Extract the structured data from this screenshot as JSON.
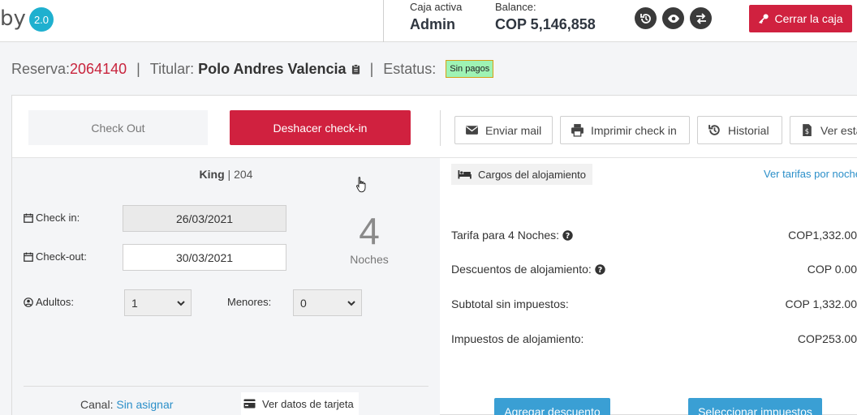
{
  "header": {
    "logo_text": "by",
    "version_badge": "2.0",
    "cash_register_label": "Caja activa",
    "cash_register_value": "Admin",
    "balance_label": "Balance:",
    "balance_value": "COP 5,146,858",
    "icons": [
      "history-icon",
      "eye-icon",
      "exchange-icon"
    ],
    "close_cash_label": "Cerrar la caja",
    "close_cash_color": "#d0213f"
  },
  "reservation": {
    "label": "Reserva:",
    "number": "2064140",
    "separator": "|",
    "holder_label": "Titular:",
    "holder_name": "Polo Andres Valencia",
    "status_label": "Estatus:",
    "status_value": "Sin pagos"
  },
  "actions": {
    "check_out": "Check Out",
    "undo_checkin": "Deshacer check-in",
    "send_mail": "Enviar mail",
    "print_checkin": "Imprimir check in",
    "history": "Historial",
    "view_statement": "Ver esta"
  },
  "room": {
    "type": "King",
    "separator": " | ",
    "number": "204"
  },
  "stay": {
    "checkin_label": "Check in:",
    "checkin_value": "26/03/2021",
    "checkout_label": "Check-out:",
    "checkout_value": "30/03/2021",
    "nights_count": "4",
    "nights_label": "Noches",
    "adults_label": "Adultos:",
    "adults_value": "1",
    "minors_label": "Menores:",
    "minors_value": "0"
  },
  "footer_left": {
    "channel_label": "Canal:",
    "channel_value": "Sin asignar",
    "card_data_label": "Ver datos de tarjeta"
  },
  "charges": {
    "tag_label": "Cargos del alojamiento",
    "rates_link": "Ver tarifas por noche",
    "rows": [
      {
        "label": "Tarifa para 4 Noches:",
        "value": "COP1,332.00",
        "help": true
      },
      {
        "label": "Descuentos de alojamiento:",
        "value": "COP 0.00",
        "help": true
      },
      {
        "label": "Subtotal sin impuestos:",
        "value": "COP 1,332.00",
        "help": false
      },
      {
        "label": "Impuestos de alojamiento:",
        "value": "COP253.00",
        "help": false
      }
    ],
    "add_discount": "Agregar descuento",
    "select_taxes": "Seleccionar impuestos"
  }
}
